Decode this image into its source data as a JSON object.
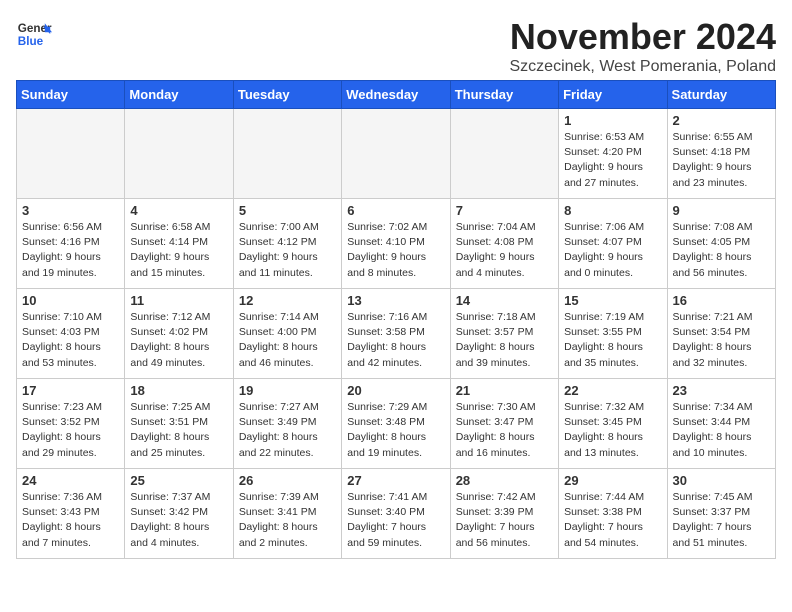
{
  "logo": {
    "general": "General",
    "blue": "Blue"
  },
  "title": "November 2024",
  "location": "Szczecinek, West Pomerania, Poland",
  "headers": [
    "Sunday",
    "Monday",
    "Tuesday",
    "Wednesday",
    "Thursday",
    "Friday",
    "Saturday"
  ],
  "weeks": [
    [
      {
        "day": "",
        "empty": true
      },
      {
        "day": "",
        "empty": true
      },
      {
        "day": "",
        "empty": true
      },
      {
        "day": "",
        "empty": true
      },
      {
        "day": "",
        "empty": true
      },
      {
        "day": "1",
        "sunrise": "Sunrise: 6:53 AM",
        "sunset": "Sunset: 4:20 PM",
        "daylight": "Daylight: 9 hours and 27 minutes."
      },
      {
        "day": "2",
        "sunrise": "Sunrise: 6:55 AM",
        "sunset": "Sunset: 4:18 PM",
        "daylight": "Daylight: 9 hours and 23 minutes."
      }
    ],
    [
      {
        "day": "3",
        "sunrise": "Sunrise: 6:56 AM",
        "sunset": "Sunset: 4:16 PM",
        "daylight": "Daylight: 9 hours and 19 minutes."
      },
      {
        "day": "4",
        "sunrise": "Sunrise: 6:58 AM",
        "sunset": "Sunset: 4:14 PM",
        "daylight": "Daylight: 9 hours and 15 minutes."
      },
      {
        "day": "5",
        "sunrise": "Sunrise: 7:00 AM",
        "sunset": "Sunset: 4:12 PM",
        "daylight": "Daylight: 9 hours and 11 minutes."
      },
      {
        "day": "6",
        "sunrise": "Sunrise: 7:02 AM",
        "sunset": "Sunset: 4:10 PM",
        "daylight": "Daylight: 9 hours and 8 minutes."
      },
      {
        "day": "7",
        "sunrise": "Sunrise: 7:04 AM",
        "sunset": "Sunset: 4:08 PM",
        "daylight": "Daylight: 9 hours and 4 minutes."
      },
      {
        "day": "8",
        "sunrise": "Sunrise: 7:06 AM",
        "sunset": "Sunset: 4:07 PM",
        "daylight": "Daylight: 9 hours and 0 minutes."
      },
      {
        "day": "9",
        "sunrise": "Sunrise: 7:08 AM",
        "sunset": "Sunset: 4:05 PM",
        "daylight": "Daylight: 8 hours and 56 minutes."
      }
    ],
    [
      {
        "day": "10",
        "sunrise": "Sunrise: 7:10 AM",
        "sunset": "Sunset: 4:03 PM",
        "daylight": "Daylight: 8 hours and 53 minutes."
      },
      {
        "day": "11",
        "sunrise": "Sunrise: 7:12 AM",
        "sunset": "Sunset: 4:02 PM",
        "daylight": "Daylight: 8 hours and 49 minutes."
      },
      {
        "day": "12",
        "sunrise": "Sunrise: 7:14 AM",
        "sunset": "Sunset: 4:00 PM",
        "daylight": "Daylight: 8 hours and 46 minutes."
      },
      {
        "day": "13",
        "sunrise": "Sunrise: 7:16 AM",
        "sunset": "Sunset: 3:58 PM",
        "daylight": "Daylight: 8 hours and 42 minutes."
      },
      {
        "day": "14",
        "sunrise": "Sunrise: 7:18 AM",
        "sunset": "Sunset: 3:57 PM",
        "daylight": "Daylight: 8 hours and 39 minutes."
      },
      {
        "day": "15",
        "sunrise": "Sunrise: 7:19 AM",
        "sunset": "Sunset: 3:55 PM",
        "daylight": "Daylight: 8 hours and 35 minutes."
      },
      {
        "day": "16",
        "sunrise": "Sunrise: 7:21 AM",
        "sunset": "Sunset: 3:54 PM",
        "daylight": "Daylight: 8 hours and 32 minutes."
      }
    ],
    [
      {
        "day": "17",
        "sunrise": "Sunrise: 7:23 AM",
        "sunset": "Sunset: 3:52 PM",
        "daylight": "Daylight: 8 hours and 29 minutes."
      },
      {
        "day": "18",
        "sunrise": "Sunrise: 7:25 AM",
        "sunset": "Sunset: 3:51 PM",
        "daylight": "Daylight: 8 hours and 25 minutes."
      },
      {
        "day": "19",
        "sunrise": "Sunrise: 7:27 AM",
        "sunset": "Sunset: 3:49 PM",
        "daylight": "Daylight: 8 hours and 22 minutes."
      },
      {
        "day": "20",
        "sunrise": "Sunrise: 7:29 AM",
        "sunset": "Sunset: 3:48 PM",
        "daylight": "Daylight: 8 hours and 19 minutes."
      },
      {
        "day": "21",
        "sunrise": "Sunrise: 7:30 AM",
        "sunset": "Sunset: 3:47 PM",
        "daylight": "Daylight: 8 hours and 16 minutes."
      },
      {
        "day": "22",
        "sunrise": "Sunrise: 7:32 AM",
        "sunset": "Sunset: 3:45 PM",
        "daylight": "Daylight: 8 hours and 13 minutes."
      },
      {
        "day": "23",
        "sunrise": "Sunrise: 7:34 AM",
        "sunset": "Sunset: 3:44 PM",
        "daylight": "Daylight: 8 hours and 10 minutes."
      }
    ],
    [
      {
        "day": "24",
        "sunrise": "Sunrise: 7:36 AM",
        "sunset": "Sunset: 3:43 PM",
        "daylight": "Daylight: 8 hours and 7 minutes."
      },
      {
        "day": "25",
        "sunrise": "Sunrise: 7:37 AM",
        "sunset": "Sunset: 3:42 PM",
        "daylight": "Daylight: 8 hours and 4 minutes."
      },
      {
        "day": "26",
        "sunrise": "Sunrise: 7:39 AM",
        "sunset": "Sunset: 3:41 PM",
        "daylight": "Daylight: 8 hours and 2 minutes."
      },
      {
        "day": "27",
        "sunrise": "Sunrise: 7:41 AM",
        "sunset": "Sunset: 3:40 PM",
        "daylight": "Daylight: 7 hours and 59 minutes."
      },
      {
        "day": "28",
        "sunrise": "Sunrise: 7:42 AM",
        "sunset": "Sunset: 3:39 PM",
        "daylight": "Daylight: 7 hours and 56 minutes."
      },
      {
        "day": "29",
        "sunrise": "Sunrise: 7:44 AM",
        "sunset": "Sunset: 3:38 PM",
        "daylight": "Daylight: 7 hours and 54 minutes."
      },
      {
        "day": "30",
        "sunrise": "Sunrise: 7:45 AM",
        "sunset": "Sunset: 3:37 PM",
        "daylight": "Daylight: 7 hours and 51 minutes."
      }
    ]
  ]
}
